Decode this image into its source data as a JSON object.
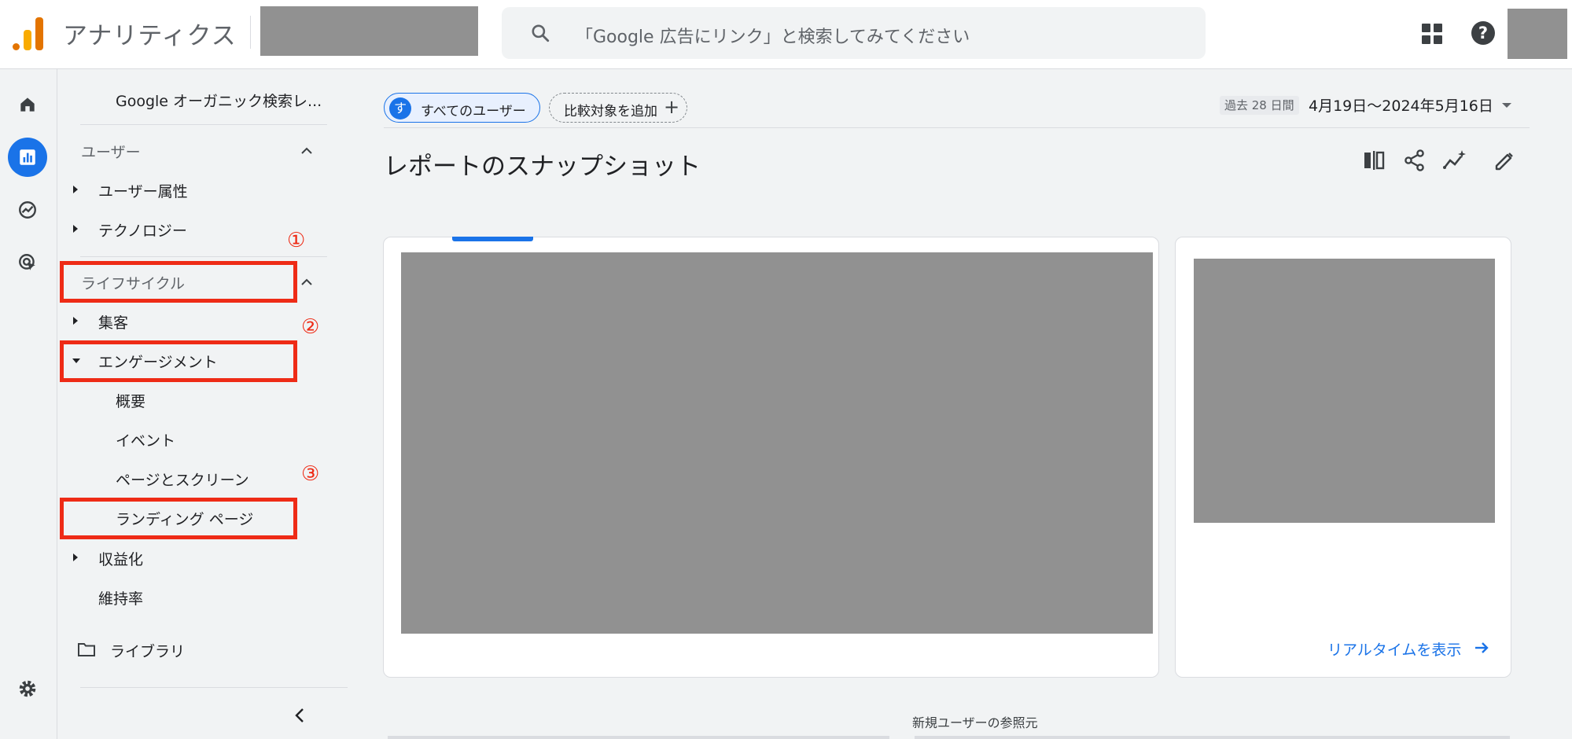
{
  "header": {
    "app_title": "アナリティクス",
    "search_placeholder": "「Google 広告にリンク」と検索してみてください",
    "apps_icon": "apps-grid-icon",
    "help_icon": "help-icon",
    "help_glyph": "?"
  },
  "rail": {
    "items": [
      {
        "name": "home-icon",
        "active": false
      },
      {
        "name": "reports-icon",
        "active": true
      },
      {
        "name": "explore-icon",
        "active": false
      },
      {
        "name": "advertising-icon",
        "active": false
      }
    ],
    "settings_icon": "gear-icon"
  },
  "sidebar": {
    "report_collection": "Google オーガニック検索レ...",
    "user_section": "ユーザー",
    "user_items": [
      "ユーザー属性",
      "テクノロジー"
    ],
    "lifecycle_section": "ライフサイクル",
    "acquisition": "集客",
    "engagement": "エンゲージメント",
    "engagement_items": [
      "概要",
      "イベント",
      "ページとスクリーン",
      "ランディング ページ"
    ],
    "monetization": "収益化",
    "retention": "維持率",
    "library": "ライブラリ",
    "annotations": [
      "①",
      "②",
      "③"
    ]
  },
  "main": {
    "segment_chip_initial": "す",
    "segment_chip_label": "すべてのユーザー",
    "compare_chip_label": "比較対象を追加",
    "compare_plus": "+",
    "date_badge": "過去 28 日間",
    "date_range": "4月19日～2024年5月16日",
    "title": "レポートのスナップショット",
    "tools": [
      "compare-icon",
      "share-icon",
      "insights-icon",
      "edit-icon"
    ],
    "realtime_link": "リアルタイムを表示",
    "bottom_card_label": "新規ユーザーの参照元"
  },
  "colors": {
    "accent": "#1a73e8",
    "annotation_red": "#ee2b16",
    "redaction_gray": "#919191",
    "logo_orange": "#e37400",
    "logo_yellow": "#f9ab00"
  }
}
